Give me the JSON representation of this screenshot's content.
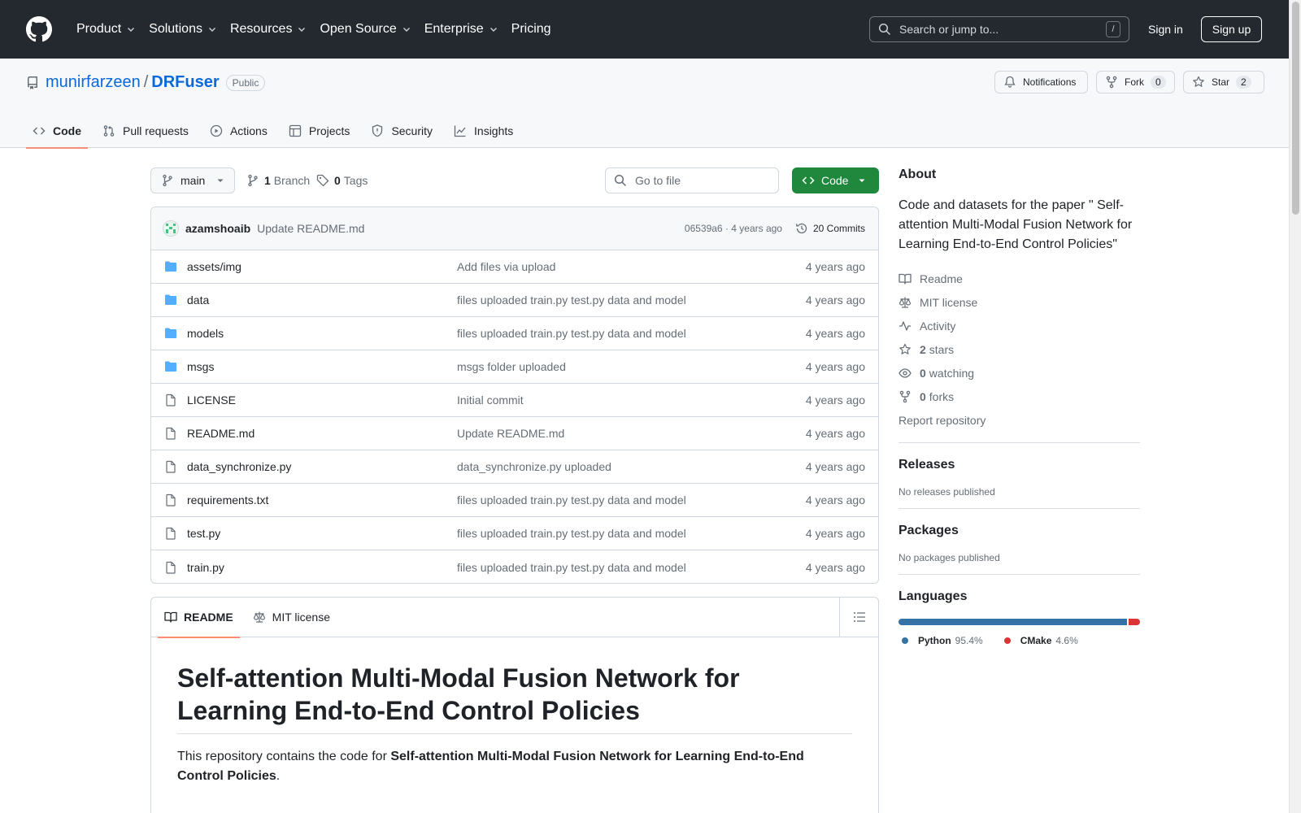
{
  "header": {
    "nav": [
      "Product",
      "Solutions",
      "Resources",
      "Open Source",
      "Enterprise",
      "Pricing"
    ],
    "search_placeholder": "Search or jump to...",
    "search_shortcut": "/",
    "signin": "Sign in",
    "signup": "Sign up"
  },
  "repo": {
    "owner": "munirfarzeen",
    "separator": "/",
    "name": "DRFuser",
    "visibility": "Public",
    "notifications": "Notifications",
    "fork_label": "Fork",
    "fork_count": "0",
    "star_label": "Star",
    "star_count": "2",
    "tabs": [
      "Code",
      "Pull requests",
      "Actions",
      "Projects",
      "Security",
      "Insights"
    ]
  },
  "toolbar": {
    "branch": "main",
    "branch_count": "1",
    "branch_label": "Branch",
    "tag_count": "0",
    "tag_label": "Tags",
    "goto_file": "Go to file",
    "code_button": "Code"
  },
  "commit": {
    "author": "azamshoaib",
    "message": "Update README.md",
    "sha_time": "06539a6 · 4 years ago",
    "commits": "20 Commits"
  },
  "files": [
    {
      "name": "assets/img",
      "message": "Add files via upload",
      "age": "4 years ago",
      "type": "dir"
    },
    {
      "name": "data",
      "message": "files uploaded train.py test.py data and model",
      "age": "4 years ago",
      "type": "dir"
    },
    {
      "name": "models",
      "message": "files uploaded train.py test.py data and model",
      "age": "4 years ago",
      "type": "dir"
    },
    {
      "name": "msgs",
      "message": "msgs folder uploaded",
      "age": "4 years ago",
      "type": "dir"
    },
    {
      "name": "LICENSE",
      "message": "Initial commit",
      "age": "4 years ago",
      "type": "file"
    },
    {
      "name": "README.md",
      "message": "Update README.md",
      "age": "4 years ago",
      "type": "file"
    },
    {
      "name": "data_synchronize.py",
      "message": "data_synchronize.py uploaded",
      "age": "4 years ago",
      "type": "file"
    },
    {
      "name": "requirements.txt",
      "message": "files uploaded train.py test.py data and model",
      "age": "4 years ago",
      "type": "file"
    },
    {
      "name": "test.py",
      "message": "files uploaded train.py test.py data and model",
      "age": "4 years ago",
      "type": "file"
    },
    {
      "name": "train.py",
      "message": "files uploaded train.py test.py data and model",
      "age": "4 years ago",
      "type": "file"
    }
  ],
  "readme": {
    "tab_readme": "README",
    "tab_license": "MIT license",
    "heading": "Self-attention Multi-Modal Fusion Network for Learning End-to-End Control Policies",
    "intro_prefix": "This repository contains the code for ",
    "intro_bold": "Self-attention Multi-Modal Fusion Network for Learning End-to-End Control Policies",
    "intro_suffix": "."
  },
  "sidebar": {
    "about_title": "About",
    "about_desc": "Code and datasets for the paper \" Self-attention Multi-Modal Fusion Network for Learning End-to-End Control Policies\"",
    "readme": "Readme",
    "license": "MIT license",
    "activity": "Activity",
    "stars_count": "2",
    "stars_label": "stars",
    "watching_count": "0",
    "watching_label": "watching",
    "forks_count": "0",
    "forks_label": "forks",
    "report": "Report repository",
    "releases_title": "Releases",
    "releases_text": "No releases published",
    "packages_title": "Packages",
    "packages_text": "No packages published",
    "languages_title": "Languages",
    "languages": [
      {
        "name": "Python",
        "percent": "95.4%",
        "value": 95.4,
        "color": "#3572A5"
      },
      {
        "name": "CMake",
        "percent": "4.6%",
        "value": 4.6,
        "color": "#DA3434"
      }
    ]
  }
}
